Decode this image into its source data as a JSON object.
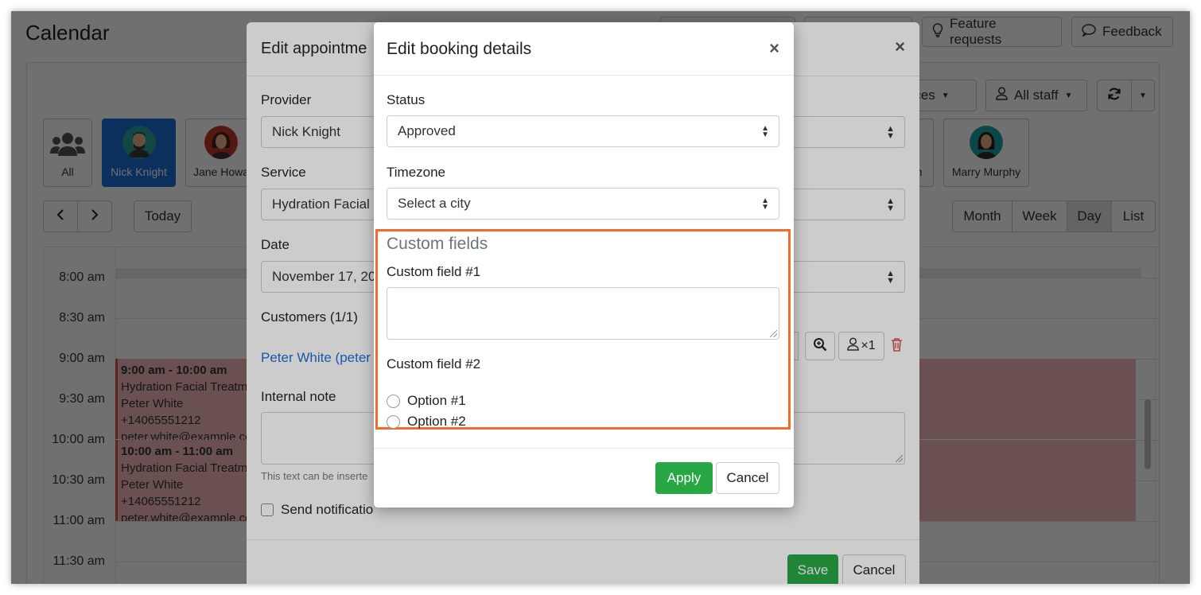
{
  "page": {
    "title": "Calendar",
    "feature_requests": "Feature requests",
    "feedback": "Feedback",
    "services_fragment": "vices",
    "all_staff": "All staff",
    "today": "Today",
    "views": [
      "Month",
      "Week",
      "Day",
      "List"
    ],
    "active_view": "Day"
  },
  "staff": [
    {
      "name": "All"
    },
    {
      "name": "Nick Knight"
    },
    {
      "name": "Jane Howa"
    },
    {
      "name": "n"
    },
    {
      "name": "Marry Murphy"
    }
  ],
  "times": [
    "8:00 am",
    "8:30 am",
    "9:00 am",
    "9:30 am",
    "10:00 am",
    "10:30 am",
    "11:00 am",
    "11:30 am"
  ],
  "events": [
    {
      "time": "9:00 am - 10:00 am",
      "service": "Hydration Facial Treatme",
      "customer": "Peter White",
      "phone": "+14065551212",
      "email": "peter.white@example.co"
    },
    {
      "time": "10:00 am - 11:00 am",
      "service": "Hydration Facial Treatme",
      "customer": "Peter White",
      "phone": "+14065551212",
      "email": "peter.white@example.co"
    }
  ],
  "appointment_modal": {
    "title": "Edit appointme",
    "provider_label": "Provider",
    "provider_value": "Nick Knight",
    "service_label": "Service",
    "service_value": "Hydration Facial",
    "date_label": "Date",
    "date_value": "November 17, 20",
    "customers_label": "Customers (1/1)",
    "customer_link": "Peter White (peter",
    "customer_count": "×1",
    "note_label": "Internal note",
    "note_hint": "This text can be inserte",
    "send_notifications": "Send notificatio",
    "save": "Save",
    "cancel": "Cancel"
  },
  "booking_modal": {
    "title": "Edit booking details",
    "close": "×",
    "status_label": "Status",
    "status_value": "Approved",
    "timezone_label": "Timezone",
    "timezone_placeholder": "Select a city",
    "custom_fields_heading": "Custom fields",
    "field1_label": "Custom field #1",
    "field1_value": "",
    "field2_label": "Custom field #2",
    "options": [
      "Option #1",
      "Option #2"
    ],
    "apply": "Apply",
    "cancel": "Cancel"
  },
  "colors": {
    "primary": "#1d6fd6",
    "success": "#28a745",
    "highlight": "#f26b2a",
    "event_bg": "#f2b9b9",
    "danger": "#d9534f"
  }
}
